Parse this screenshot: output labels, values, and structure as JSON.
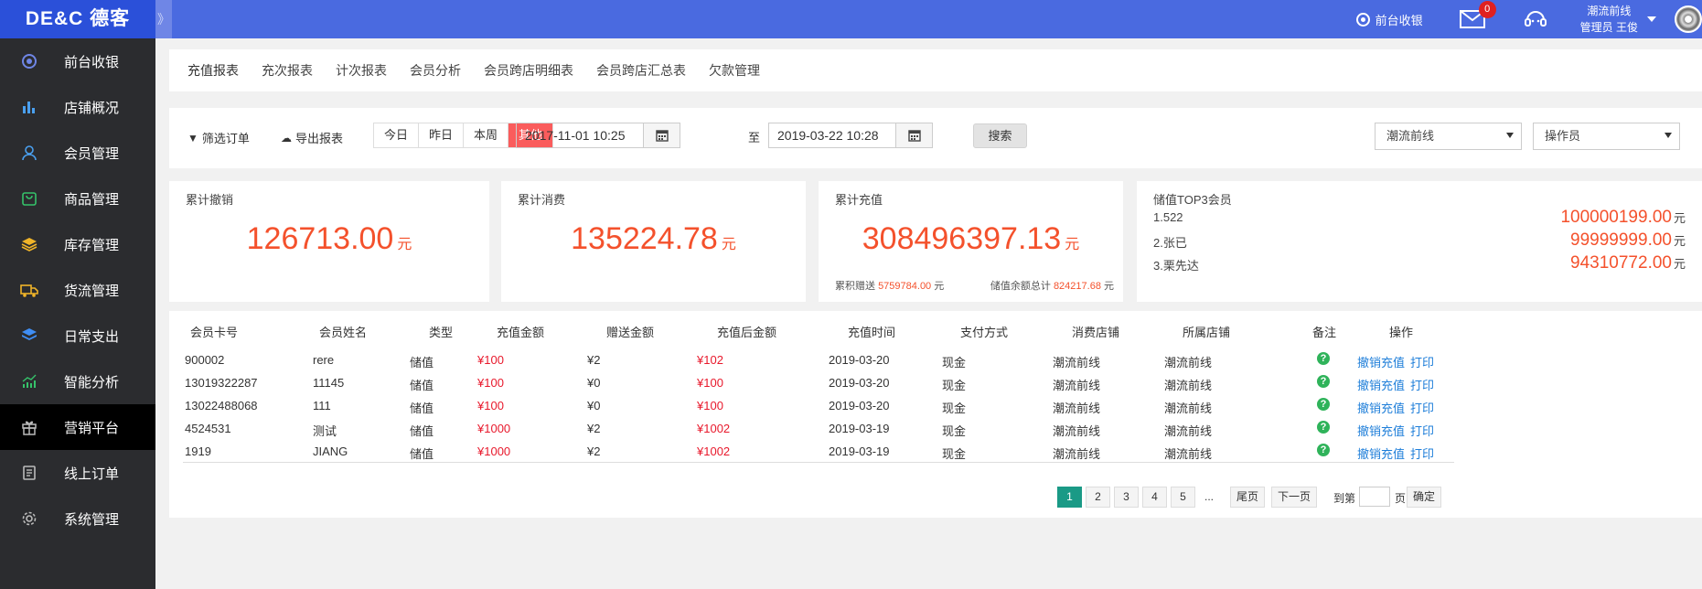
{
  "header": {
    "logo": "DE&C 德客",
    "collapse_glyph": "》",
    "cashier_label": "前台收银",
    "mail_badge": "0",
    "store_name": "潮流前线",
    "user_role": "管理员 王俊"
  },
  "sidebar": {
    "items": [
      {
        "label": "前台收银",
        "icon": "cashier-icon",
        "color": "#6f86e6"
      },
      {
        "label": "店铺概况",
        "icon": "bar-chart-icon",
        "color": "#4aa0f0"
      },
      {
        "label": "会员管理",
        "icon": "user-icon",
        "color": "#4aa0f0"
      },
      {
        "label": "商品管理",
        "icon": "bag-icon",
        "color": "#35c26a"
      },
      {
        "label": "库存管理",
        "icon": "layers-icon",
        "color": "#f0b429"
      },
      {
        "label": "货流管理",
        "icon": "truck-icon",
        "color": "#f0b429"
      },
      {
        "label": "日常支出",
        "icon": "stack-icon",
        "color": "#3f8ef5"
      },
      {
        "label": "智能分析",
        "icon": "trend-icon",
        "color": "#35c26a"
      },
      {
        "label": "营销平台",
        "icon": "gift-icon",
        "color": "#bbbbbb"
      },
      {
        "label": "线上订单",
        "icon": "order-icon",
        "color": "#bbbbbb"
      },
      {
        "label": "系统管理",
        "icon": "gear-icon",
        "color": "#bbbbbb"
      }
    ],
    "active_index": 8
  },
  "tabs": [
    "充值报表",
    "充次报表",
    "计次报表",
    "会员分析",
    "会员跨店明细表",
    "会员跨店汇总表",
    "欠款管理"
  ],
  "filter": {
    "filter_label": "筛选订单",
    "export_label": "导出报表",
    "quick": [
      "今日",
      "昨日",
      "本周",
      "其他"
    ],
    "start_date": "2017-11-01 10:25",
    "to_label": "至",
    "end_date": "2019-03-22 10:28",
    "search_label": "搜索",
    "store_select": "潮流前线",
    "operator_select": "操作员"
  },
  "cards": {
    "cancel": {
      "title": "累计撤销",
      "value": "126713.00",
      "unit": "元"
    },
    "consume": {
      "title": "累计消费",
      "value": "135224.78",
      "unit": "元"
    },
    "recharge": {
      "title": "累计充值",
      "value": "308496397.13",
      "unit": "元",
      "gift_label": "累积赠送",
      "gift_value": "5759784.00",
      "gift_unit": "元",
      "balance_label": "储值余额总计",
      "balance_value": "824217.68",
      "balance_unit": "元"
    },
    "top3": {
      "title": "储值TOP3会员",
      "unit": "元",
      "rows": [
        {
          "name": "1.522",
          "value": "100000199.00"
        },
        {
          "name": "2.张已",
          "value": "99999999.00"
        },
        {
          "name": "3.栗先达",
          "value": "94310772.00"
        }
      ]
    }
  },
  "table": {
    "headers": [
      "会员卡号",
      "会员姓名",
      "类型",
      "充值金额",
      "赠送金额",
      "充值后金额",
      "充值时间",
      "支付方式",
      "消费店铺",
      "所属店铺",
      "备注",
      "操作"
    ],
    "rows": [
      [
        "900002",
        "rere",
        "储值",
        "¥100",
        "¥2",
        "¥102",
        "2019-03-20",
        "现金",
        "潮流前线",
        "潮流前线"
      ],
      [
        "13019322287",
        "11145",
        "储值",
        "¥100",
        "¥0",
        "¥100",
        "2019-03-20",
        "现金",
        "潮流前线",
        "潮流前线"
      ],
      [
        "13022488068",
        "111",
        "储值",
        "¥100",
        "¥0",
        "¥100",
        "2019-03-20",
        "现金",
        "潮流前线",
        "潮流前线"
      ],
      [
        "4524531",
        "测试",
        "储值",
        "¥1000",
        "¥2",
        "¥1002",
        "2019-03-19",
        "现金",
        "潮流前线",
        "潮流前线"
      ],
      [
        "1919",
        "JIANG",
        "储值",
        "¥1000",
        "¥2",
        "¥1002",
        "2019-03-19",
        "现金",
        "潮流前线",
        "潮流前线"
      ]
    ],
    "note_glyph": "?",
    "action_cancel": "撤销充值",
    "action_print": "打印"
  },
  "pager": {
    "pages": [
      "1",
      "2",
      "3",
      "4",
      "5"
    ],
    "ellipsis": "...",
    "last": "尾页",
    "next": "下一页",
    "goto_label": "到第",
    "page_unit": "页",
    "confirm": "确定"
  },
  "colors": {
    "accent": "#4a6ae0",
    "red": "#f4512c",
    "link": "#1e7ed9",
    "pager_active": "#1a9a86"
  }
}
